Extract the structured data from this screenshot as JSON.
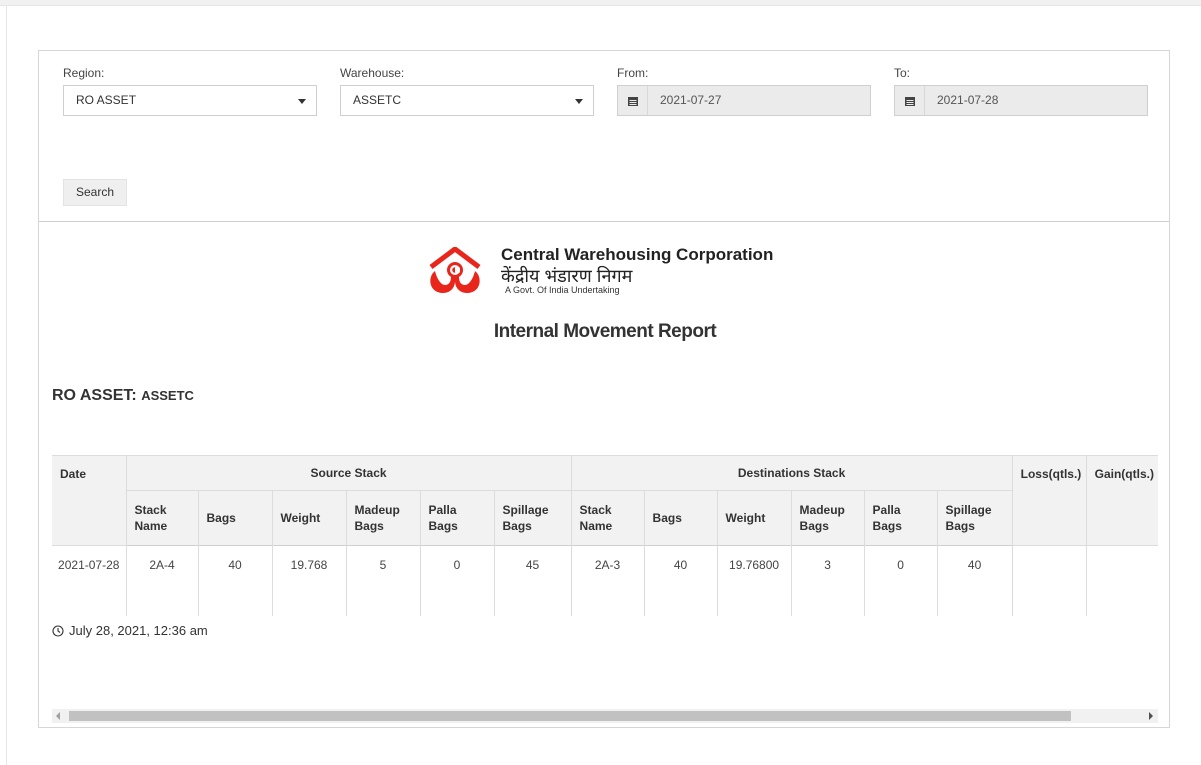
{
  "filters": {
    "region": {
      "label": "Region:",
      "value": "RO ASSET"
    },
    "warehouse": {
      "label": "Warehouse:",
      "value": "ASSETC"
    },
    "from": {
      "label": "From:",
      "value": "2021-07-27"
    },
    "to": {
      "label": "To:",
      "value": "2021-07-28"
    },
    "search_label": "Search"
  },
  "brand": {
    "name_en": "Central Warehousing Corporation",
    "name_hi": "केंद्रीय भंडारण निगम",
    "tagline": "A Govt. Of India Undertaking",
    "logo_color": "#e8261c"
  },
  "report": {
    "title": "Internal Movement Report",
    "region": "RO ASSET:",
    "warehouse": "ASSETC"
  },
  "table": {
    "date_header": "Date",
    "source_header": "Source Stack",
    "dest_header": "Destinations Stack",
    "loss_header": "Loss(qtls.)",
    "gain_header": "Gain(qtls.)",
    "sub_headers": {
      "stack_name": "Stack Name",
      "bags": "Bags",
      "weight": "Weight",
      "madeup_bags": "Madeup Bags",
      "palla_bags": "Palla Bags",
      "spillage_bags": "Spillage Bags"
    },
    "rows": [
      {
        "date": "2021-07-28",
        "src_stack": "2A-4",
        "src_bags": "40",
        "src_weight": "19.768",
        "src_madeup": "5",
        "src_palla": "0",
        "src_spillage": "45",
        "dst_stack": "2A-3",
        "dst_bags": "40",
        "dst_weight": "19.76800",
        "dst_madeup": "3",
        "dst_palla": "0",
        "dst_spillage": "40",
        "loss": "",
        "gain": ""
      }
    ]
  },
  "timestamp": "July 28, 2021, 12:36 am"
}
